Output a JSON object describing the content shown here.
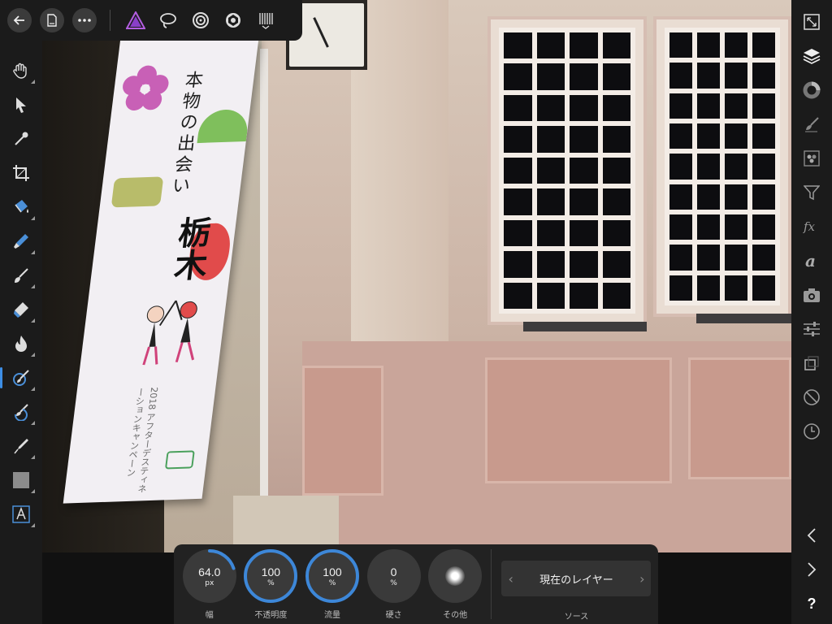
{
  "app": {
    "accent": "#3d87d8",
    "name": "Affinity Photo"
  },
  "topbar": {
    "icons": [
      "back-icon",
      "document-icon",
      "more-icon",
      "affinity-photo-persona-icon",
      "liquify-persona-icon",
      "develop-persona-icon",
      "tone-mapping-persona-icon",
      "export-persona-icon"
    ]
  },
  "left_tools": [
    "hand",
    "move",
    "color-picker",
    "crop",
    "flood-fill",
    "paint-brush",
    "brush",
    "eraser",
    "burn",
    "clone-brush",
    "healing-brush",
    "pen",
    "rectangle-shape",
    "text"
  ],
  "active_tool": "clone-brush",
  "right_studios": [
    "fit-view",
    "layers",
    "color",
    "brush",
    "channels",
    "filter",
    "effects",
    "text-styles",
    "snapshots",
    "adjustments",
    "transform",
    "restricted",
    "history"
  ],
  "banner": {
    "vertical_text": "本物の出会い",
    "big_text": "栃木",
    "small_text": "2018 アフターデスティネーションキャンペーン"
  },
  "context": {
    "width": {
      "value": "64.0",
      "unit": "px",
      "label": "幅",
      "arc_percent": 20
    },
    "opacity": {
      "value": "100",
      "unit": "%",
      "label": "不透明度"
    },
    "flow": {
      "value": "100",
      "unit": "%",
      "label": "流量"
    },
    "hardness": {
      "value": "0",
      "unit": "%",
      "label": "硬さ"
    },
    "more": {
      "label": "その他"
    },
    "source": {
      "value": "現在のレイヤー",
      "label": "ソース",
      "prev": "‹",
      "next": "›"
    }
  },
  "rightbar": {
    "help": "?",
    "prev": "‹",
    "next": "›"
  }
}
